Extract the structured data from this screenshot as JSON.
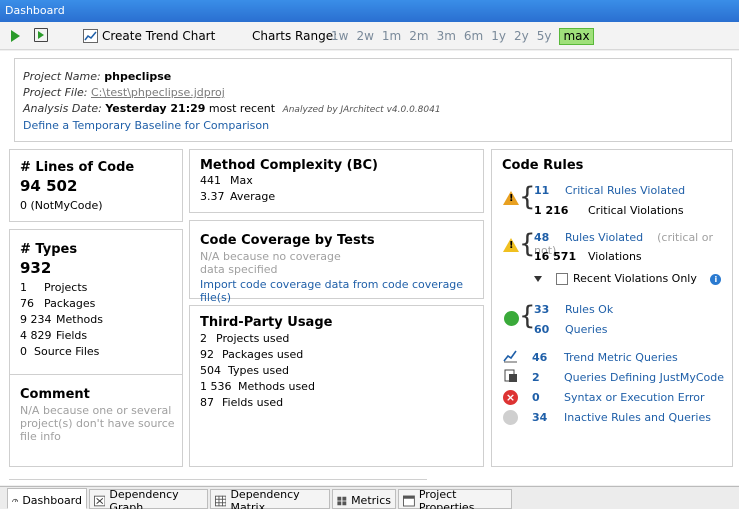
{
  "window": {
    "title": "Dashboard"
  },
  "toolbar": {
    "create_trend_chart": "Create Trend Chart",
    "charts_range_label": "Charts Range:",
    "range_options": [
      "1w",
      "2w",
      "1m",
      "2m",
      "3m",
      "6m",
      "1y",
      "2y",
      "5y",
      "max"
    ],
    "range_selected": "max"
  },
  "project_info": {
    "name_label": "Project Name:",
    "name_value": "phpeclipse",
    "file_label": "Project File:",
    "file_value": "C:\\test\\phpeclipse.jdproj",
    "date_label": "Analysis Date:",
    "date_value": "Yesterday 21:29",
    "date_suffix": "most recent",
    "analyzed_by": "Analyzed by JArchitect v4.0.0.8041",
    "baseline_link": "Define a Temporary Baseline for Comparison"
  },
  "loc": {
    "title": "# Lines of Code",
    "value": "94 502",
    "notmycode": "0  (NotMyCode)"
  },
  "types": {
    "title": "# Types",
    "value": "932",
    "rows": [
      {
        "n": "1",
        "label": "Projects"
      },
      {
        "n": "76",
        "label": "Packages"
      },
      {
        "n": "9 234",
        "label": "Methods"
      },
      {
        "n": "4 829",
        "label": "Fields"
      },
      {
        "n": "0",
        "label": "Source Files"
      }
    ]
  },
  "comment": {
    "title": "Comment",
    "text": "N/A because one or several project(s) don't have source file info"
  },
  "method_complexity": {
    "title": "Method Complexity (BC)",
    "rows": [
      {
        "n": "441",
        "label": "Max"
      },
      {
        "n": "3.37",
        "label": "Average"
      }
    ]
  },
  "coverage": {
    "title": "Code Coverage by Tests",
    "na_line1": "N/A because no coverage",
    "na_line2": "data specified",
    "import_link": "Import code coverage data from code coverage file(s)"
  },
  "third_party": {
    "title": "Third-Party Usage",
    "rows": [
      {
        "n": "2",
        "label": "Projects used"
      },
      {
        "n": "92",
        "label": "Packages used"
      },
      {
        "n": "504",
        "label": "Types used"
      },
      {
        "n": "1 536",
        "label": "Methods used"
      },
      {
        "n": "87",
        "label": "Fields used"
      }
    ]
  },
  "code_rules": {
    "title": "Code Rules",
    "critical_rules_n": "11",
    "critical_rules_label": "Critical Rules Violated",
    "critical_violations_n": "1 216",
    "critical_violations_label": "Critical Violations",
    "rules_violated_n": "48",
    "rules_violated_label": "Rules Violated",
    "critical_or_not": "(critical or not)",
    "violations_n": "16 571",
    "violations_label": "Violations",
    "recent_only_label": "Recent Violations Only",
    "rules_ok_n": "33",
    "rules_ok_label": "Rules Ok",
    "queries_n": "60",
    "queries_label": "Queries",
    "trend_n": "46",
    "trend_label": "Trend Metric Queries",
    "justmycode_n": "2",
    "justmycode_label": "Queries Defining JustMyCode",
    "error_n": "0",
    "error_label": "Syntax or Execution Error",
    "inactive_n": "34",
    "inactive_label": "Inactive Rules and Queries"
  },
  "tabs": [
    {
      "label": "Dashboard",
      "active": true
    },
    {
      "label": "Dependency Graph"
    },
    {
      "label": "Dependency Matrix"
    },
    {
      "label": "Metrics"
    },
    {
      "label": "Project Properties"
    }
  ],
  "colors": {
    "link": "#1f5fa8",
    "titlebar": "#2a6fd0",
    "active_range": "#9fe07a"
  }
}
